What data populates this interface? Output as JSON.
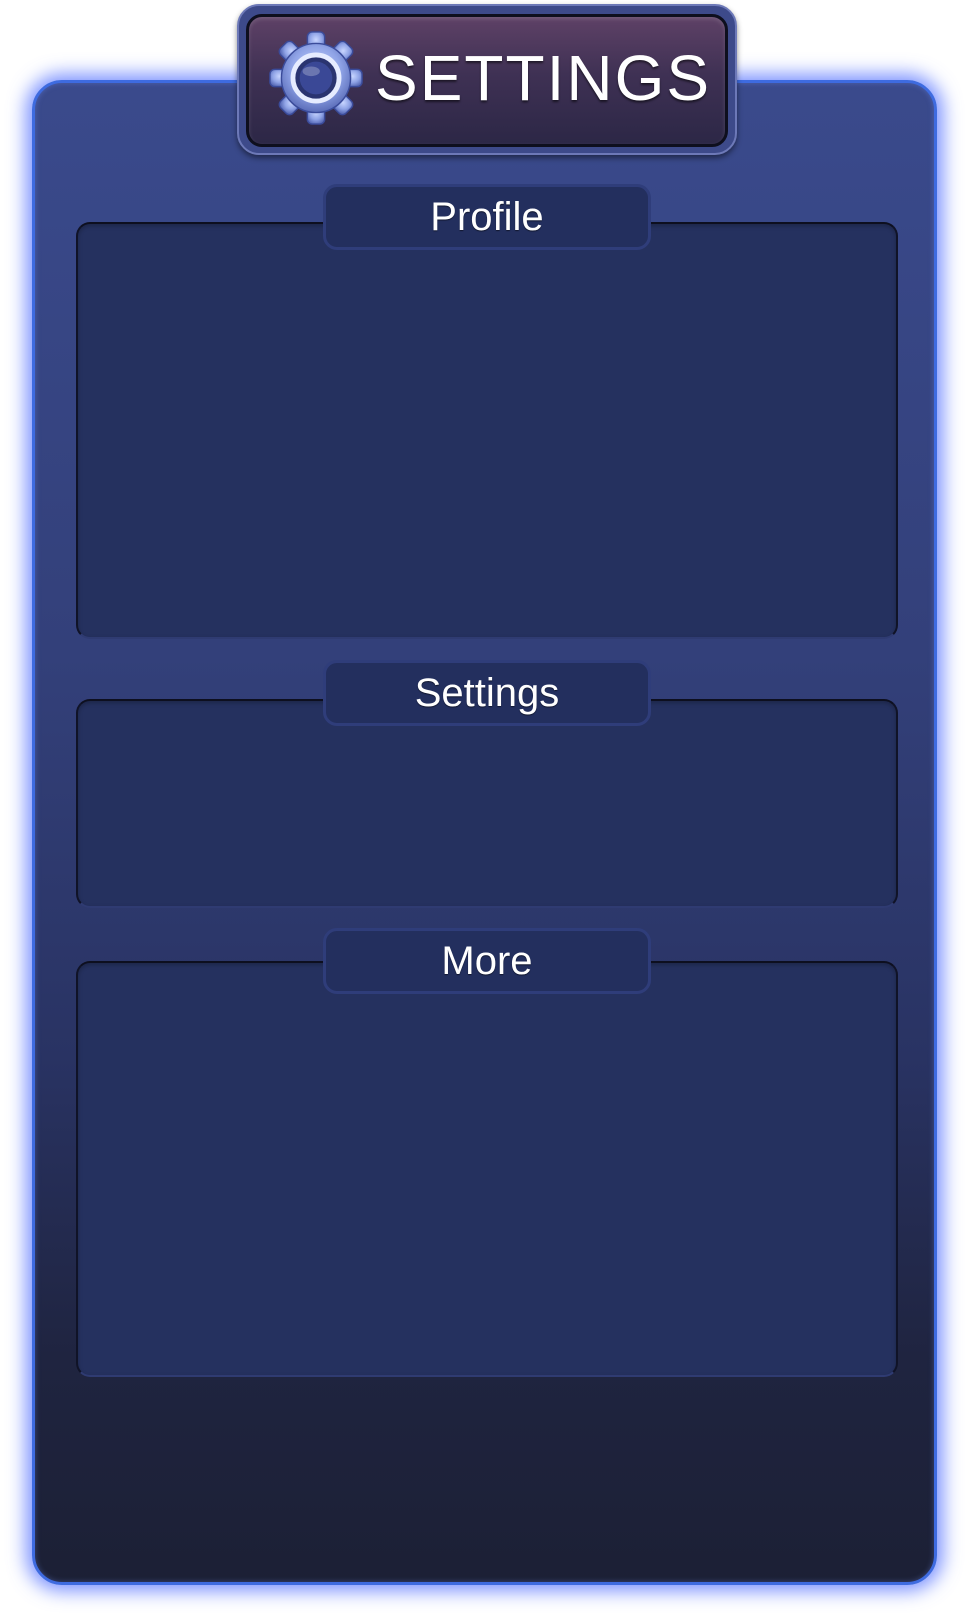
{
  "header": {
    "title": "SETTINGS",
    "icon": "gear-icon"
  },
  "sections": [
    {
      "title": "Profile"
    },
    {
      "title": "Settings"
    },
    {
      "title": "More"
    }
  ],
  "colors": {
    "panel_top": "#3a4a8c",
    "panel_bottom": "#1c2035",
    "panel_glow": "#3e6be0",
    "section_fill": "#25315f",
    "header_fill": "#3f3154",
    "text": "#ffffff"
  }
}
